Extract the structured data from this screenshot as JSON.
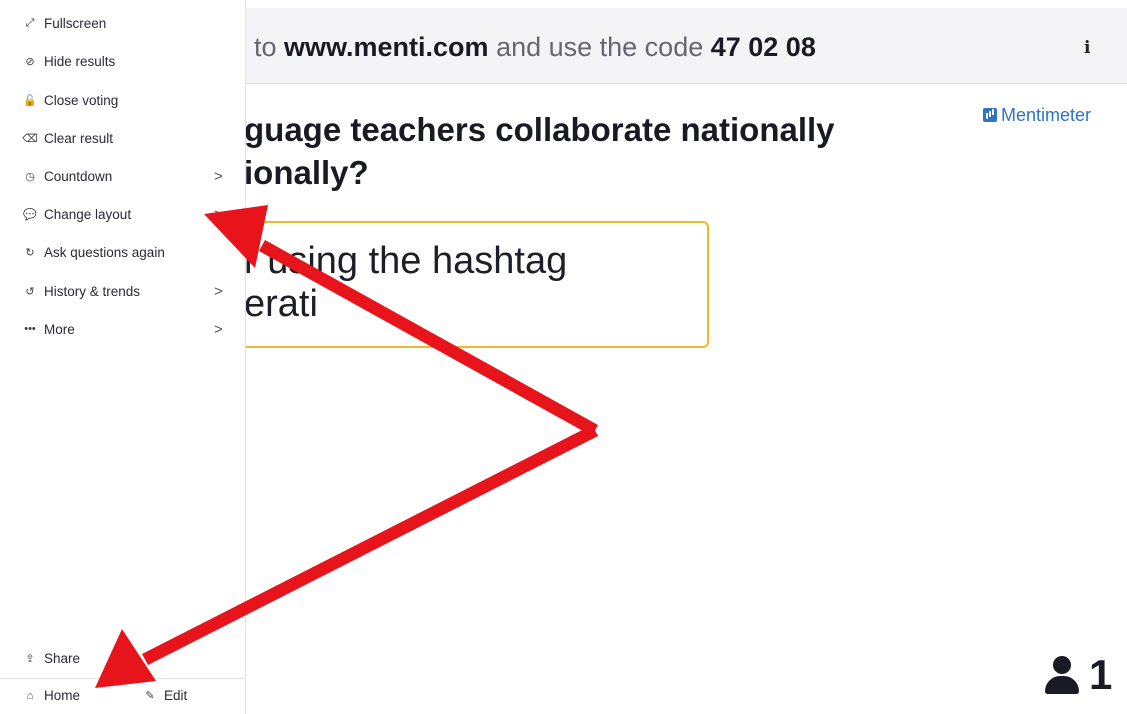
{
  "topbar": {
    "join_prefix": "to ",
    "join_url": "www.menti.com",
    "join_middle": " and use the code ",
    "join_code": "47 02 08",
    "info_icon": "i"
  },
  "brand": {
    "name": "Mentimeter",
    "color": "#2e74c4"
  },
  "question": {
    "line1": "guage teachers collaborate nationally",
    "line2": "ionally?"
  },
  "answer": {
    "line1": "r using the hashtag",
    "line2": "erati",
    "border_color": "#f0b72f"
  },
  "participants": {
    "count": "1",
    "icon": "person-icon"
  },
  "sidebar": {
    "items": [
      {
        "label": "Fullscreen",
        "icon": "expand-icon",
        "glyph": "⤢",
        "chevron": false
      },
      {
        "label": "Hide results",
        "icon": "eye-slash-icon",
        "glyph": "⊘",
        "chevron": false
      },
      {
        "label": "Close voting",
        "icon": "unlock-icon",
        "glyph": "🔓",
        "chevron": false
      },
      {
        "label": "Clear result",
        "icon": "eraser-icon",
        "glyph": "⌫",
        "chevron": false
      },
      {
        "label": "Countdown",
        "icon": "clock-icon",
        "glyph": "◷",
        "chevron": true
      },
      {
        "label": "Change layout",
        "icon": "chat-bubbles-icon",
        "glyph": "💬",
        "chevron": true
      },
      {
        "label": "Ask questions again",
        "icon": "refresh-icon",
        "glyph": "↻",
        "chevron": false
      },
      {
        "label": "History & trends",
        "icon": "history-icon",
        "glyph": "↺",
        "chevron": true
      },
      {
        "label": "More",
        "icon": "ellipsis-icon",
        "glyph": "•••",
        "chevron": true
      }
    ],
    "chevron_glyph": ">",
    "share": {
      "label": "Share",
      "glyph": "⇪"
    },
    "home": {
      "label": "Home",
      "glyph": "⌂"
    },
    "edit": {
      "label": "Edit",
      "glyph": "✎"
    }
  },
  "annotation": {
    "arrow_color": "#e8141c"
  }
}
